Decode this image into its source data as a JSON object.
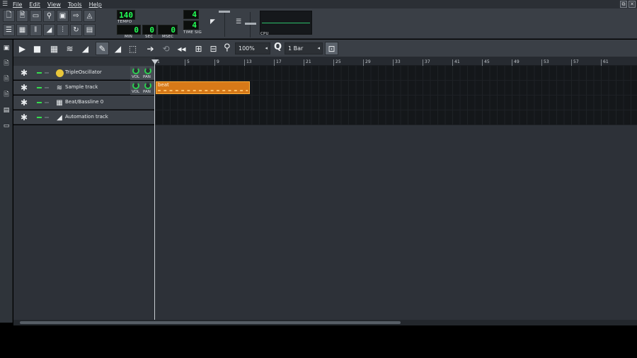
{
  "menubar": {
    "app_icon": "☰",
    "items": [
      "File",
      "Edit",
      "View",
      "Tools",
      "Help"
    ]
  },
  "window_controls": {
    "restore": "⧉",
    "close": "✕"
  },
  "transport": {
    "tempo_value": "140",
    "tempo_label": "TEMPO",
    "time_min": "0",
    "time_sec": "0",
    "time_msec": "0",
    "min_label": "MIN",
    "sec_label": "SEC",
    "msec_label": "MSEC",
    "timesig_num": "4",
    "timesig_den": "4",
    "timesig_label": "TIME SIG",
    "cpu_label": "CPU"
  },
  "song_editor": {
    "zoom_value": "100%",
    "quantize_value": "1 Bar",
    "ruler_ticks": [
      "1",
      "5",
      "9",
      "13",
      "17",
      "21",
      "25",
      "29",
      "33",
      "37",
      "41",
      "45",
      "49",
      "53",
      "57",
      "61"
    ],
    "tracks": [
      {
        "name": "TripleOscillator",
        "icon": "triple-oscillator-icon",
        "vol_label": "VOL",
        "pan_label": "PAN"
      },
      {
        "name": "Sample track",
        "icon": "waveform-icon",
        "vol_label": "VOL",
        "pan_label": "PAN",
        "pattern": {
          "label": "beat"
        }
      },
      {
        "name": "Beat/Bassline 0",
        "icon": "beat-bassline-icon"
      },
      {
        "name": "Automation track",
        "icon": "automation-icon"
      }
    ]
  },
  "colors": {
    "lcd_green": "#22ff55",
    "pattern_orange": "#d77918",
    "background": "#2d3138"
  }
}
